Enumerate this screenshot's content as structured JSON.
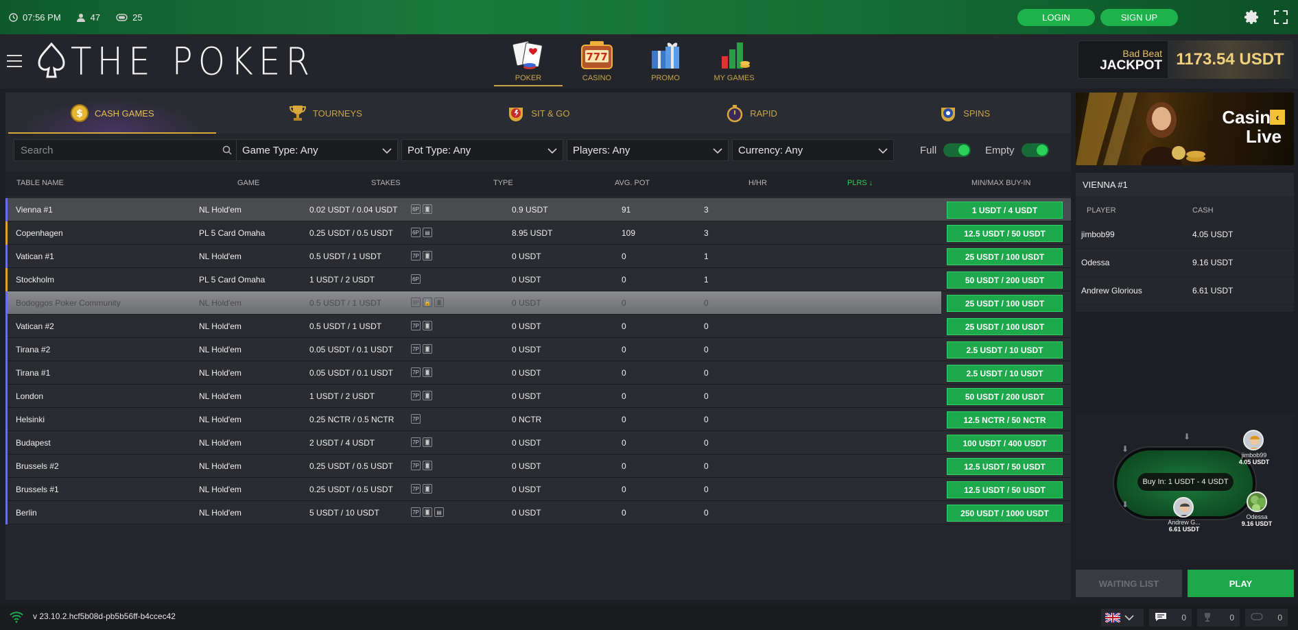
{
  "topbar": {
    "time": "07:56 PM",
    "players_online": "47",
    "tables_count": "25",
    "login_label": "LOGIN",
    "signup_label": "SIGN UP"
  },
  "brand": {
    "logo_text": "THE POKER"
  },
  "main_nav": [
    {
      "label": "POKER",
      "icon": "cards-icon",
      "active": true
    },
    {
      "label": "CASINO",
      "icon": "slot-777-icon",
      "active": false
    },
    {
      "label": "PROMO",
      "icon": "gift-icon",
      "active": false
    },
    {
      "label": "MY GAMES",
      "icon": "chips-chart-icon",
      "active": false
    }
  ],
  "jackpot": {
    "label_small": "Bad Beat",
    "label_big": "JACKPOT",
    "value": "1173.54 USDT"
  },
  "tabs": [
    {
      "label": "CASH GAMES",
      "icon": "dollar-coin-icon",
      "active": true
    },
    {
      "label": "TOURNEYS",
      "icon": "trophy-icon",
      "active": false
    },
    {
      "label": "SIT & GO",
      "icon": "sitgo-badge-icon",
      "active": false
    },
    {
      "label": "RAPID",
      "icon": "stopwatch-icon",
      "active": false
    },
    {
      "label": "SPINS",
      "icon": "spins-badge-icon",
      "active": false
    }
  ],
  "filters": {
    "search_placeholder": "Search",
    "game_type": "Game Type: Any",
    "pot_type": "Pot Type: Any",
    "players": "Players: Any",
    "currency": "Currency: Any",
    "full_label": "Full",
    "empty_label": "Empty"
  },
  "table_headers": {
    "name": "TABLE NAME",
    "game": "GAME",
    "stakes": "STAKES",
    "type": "TYPE",
    "avg_pot": "AVG. POT",
    "hhr": "H/HR",
    "plrs": "PLRS ↓",
    "buyin": "MIN/MAX BUY-IN"
  },
  "rows": [
    {
      "name": "Vienna #1",
      "game": "NL Hold'em",
      "stakes": "0.02 USDT / 0.04 USDT",
      "types": [
        "6P",
        "🂠"
      ],
      "avg_pot": "0.9 USDT",
      "hhr": "91",
      "plrs": "3",
      "buyin": "1 USDT / 4 USDT",
      "stripe": "holdem",
      "state": "highlight"
    },
    {
      "name": "Copenhagen",
      "game": "PL 5 Card Omaha",
      "stakes": "0.25 USDT / 0.5 USDT",
      "types": [
        "6P",
        "▤"
      ],
      "avg_pot": "8.95 USDT",
      "hhr": "109",
      "plrs": "3",
      "buyin": "12.5 USDT / 50 USDT",
      "stripe": "omaha",
      "state": ""
    },
    {
      "name": "Vatican #1",
      "game": "NL Hold'em",
      "stakes": "0.5 USDT / 1 USDT",
      "types": [
        "7P",
        "🂠"
      ],
      "avg_pot": "0 USDT",
      "hhr": "0",
      "plrs": "1",
      "buyin": "25 USDT / 100 USDT",
      "stripe": "holdem",
      "state": ""
    },
    {
      "name": "Stockholm",
      "game": "PL 5 Card Omaha",
      "stakes": "1 USDT / 2 USDT",
      "types": [
        "6P"
      ],
      "avg_pot": "0 USDT",
      "hhr": "0",
      "plrs": "1",
      "buyin": "50 USDT / 200 USDT",
      "stripe": "omaha",
      "state": ""
    },
    {
      "name": "Bodoggos Poker Community",
      "game": "NL Hold'em",
      "stakes": "0.5 USDT / 1 USDT",
      "types": [
        "9P",
        "🔒",
        "🂠"
      ],
      "avg_pot": "0 USDT",
      "hhr": "0",
      "plrs": "0",
      "buyin": "25 USDT / 100 USDT",
      "stripe": "holdem",
      "state": "disabled"
    },
    {
      "name": "Vatican #2",
      "game": "NL Hold'em",
      "stakes": "0.5 USDT / 1 USDT",
      "types": [
        "7P",
        "🂠"
      ],
      "avg_pot": "0 USDT",
      "hhr": "0",
      "plrs": "0",
      "buyin": "25 USDT / 100 USDT",
      "stripe": "holdem",
      "state": ""
    },
    {
      "name": "Tirana #2",
      "game": "NL Hold'em",
      "stakes": "0.05 USDT / 0.1 USDT",
      "types": [
        "7P",
        "🂠"
      ],
      "avg_pot": "0 USDT",
      "hhr": "0",
      "plrs": "0",
      "buyin": "2.5 USDT / 10 USDT",
      "stripe": "holdem",
      "state": ""
    },
    {
      "name": "Tirana #1",
      "game": "NL Hold'em",
      "stakes": "0.05 USDT / 0.1 USDT",
      "types": [
        "7P",
        "🂠"
      ],
      "avg_pot": "0 USDT",
      "hhr": "0",
      "plrs": "0",
      "buyin": "2.5 USDT / 10 USDT",
      "stripe": "holdem",
      "state": ""
    },
    {
      "name": "London",
      "game": "NL Hold'em",
      "stakes": "1 USDT / 2 USDT",
      "types": [
        "7P",
        "🂠"
      ],
      "avg_pot": "0 USDT",
      "hhr": "0",
      "plrs": "0",
      "buyin": "50 USDT / 200 USDT",
      "stripe": "holdem",
      "state": ""
    },
    {
      "name": "Helsinki",
      "game": "NL Hold'em",
      "stakes": "0.25 NCTR / 0.5 NCTR",
      "types": [
        "7P"
      ],
      "avg_pot": "0 NCTR",
      "hhr": "0",
      "plrs": "0",
      "buyin": "12.5 NCTR / 50 NCTR",
      "stripe": "holdem",
      "state": ""
    },
    {
      "name": "Budapest",
      "game": "NL Hold'em",
      "stakes": "2 USDT / 4 USDT",
      "types": [
        "7P",
        "🂠"
      ],
      "avg_pot": "0 USDT",
      "hhr": "0",
      "plrs": "0",
      "buyin": "100 USDT / 400 USDT",
      "stripe": "holdem",
      "state": ""
    },
    {
      "name": "Brussels #2",
      "game": "NL Hold'em",
      "stakes": "0.25 USDT / 0.5 USDT",
      "types": [
        "7P",
        "🂠"
      ],
      "avg_pot": "0 USDT",
      "hhr": "0",
      "plrs": "0",
      "buyin": "12.5 USDT / 50 USDT",
      "stripe": "holdem",
      "state": ""
    },
    {
      "name": "Brussels #1",
      "game": "NL Hold'em",
      "stakes": "0.25 USDT / 0.5 USDT",
      "types": [
        "7P",
        "🂠"
      ],
      "avg_pot": "0 USDT",
      "hhr": "0",
      "plrs": "0",
      "buyin": "12.5 USDT / 50 USDT",
      "stripe": "holdem",
      "state": ""
    },
    {
      "name": "Berlin",
      "game": "NL Hold'em",
      "stakes": "5 USDT / 10 USDT",
      "types": [
        "7P",
        "🂠",
        "▤"
      ],
      "avg_pot": "0 USDT",
      "hhr": "0",
      "plrs": "0",
      "buyin": "250 USDT / 1000 USDT",
      "stripe": "holdem",
      "state": ""
    }
  ],
  "promo": {
    "line1": "Casino",
    "line2": "Live"
  },
  "detail": {
    "title": "VIENNA #1",
    "col_player": "PLAYER",
    "col_cash": "CASH",
    "players": [
      {
        "name": "jimbob99",
        "cash": "4.05 USDT"
      },
      {
        "name": "Odessa",
        "cash": "9.16 USDT"
      },
      {
        "name": "Andrew Glorious",
        "cash": "6.61 USDT"
      }
    ]
  },
  "preview": {
    "buyin_text": "Buy In: 1 USDT - 4 USDT",
    "seats": [
      {
        "name": "jimbob99",
        "cash": "4.05 USDT"
      },
      {
        "name": "Odessa",
        "cash": "9.16 USDT"
      },
      {
        "name": "Andrew G...",
        "cash": "6.61 USDT"
      }
    ]
  },
  "actions": {
    "waiting_list": "WAITING LIST",
    "play": "PLAY"
  },
  "footer": {
    "version": "v 23.10.2.hcf5b08d-pb5b56ff-b4ccec42",
    "chat_count": "0",
    "tourney_count": "0",
    "cash_count": "0"
  },
  "colors": {
    "accent_green": "#1ea84c",
    "gold": "#c9a64b",
    "holdem_stripe": "#6a6ef0",
    "omaha_stripe": "#e2a52b"
  }
}
